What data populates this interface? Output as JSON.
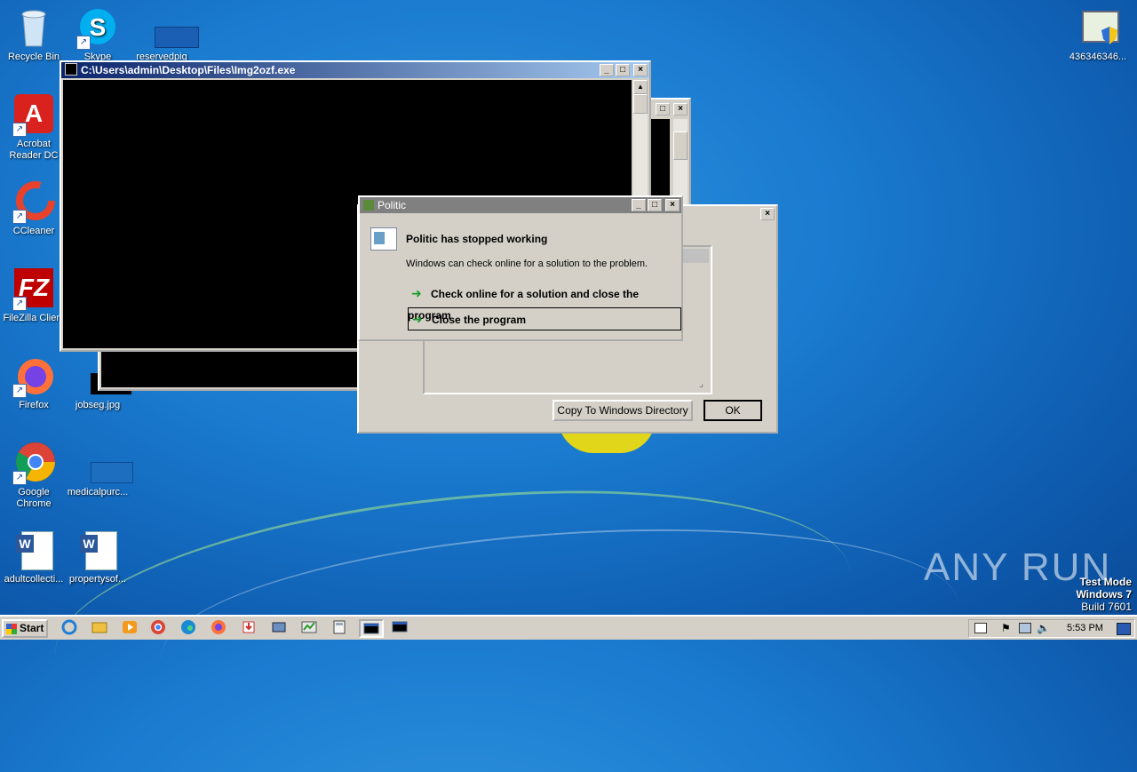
{
  "desktop": {
    "icons": [
      {
        "label": "Recycle Bin",
        "icon": "recycle-bin-icon"
      },
      {
        "label": "Skype",
        "icon": "skype-icon"
      },
      {
        "label": "reservedpig",
        "icon": "image-file-icon"
      },
      {
        "label": "Acrobat Reader DC",
        "icon": "acrobat-icon"
      },
      {
        "label": "CCleaner",
        "icon": "ccleaner-icon"
      },
      {
        "label": "FileZilla Client",
        "icon": "filezilla-icon"
      },
      {
        "label": "Firefox",
        "icon": "firefox-icon"
      },
      {
        "label": "jobseg.jpg",
        "icon": "image-file-icon"
      },
      {
        "label": "Google Chrome",
        "icon": "chrome-icon"
      },
      {
        "label": "medicalpurc...",
        "icon": "image-file-icon"
      },
      {
        "label": "adultcollecti...",
        "icon": "word-doc-icon"
      },
      {
        "label": "propertysof...",
        "icon": "word-doc-icon"
      },
      {
        "label": "436346346...",
        "icon": "shield-app-icon"
      }
    ],
    "watermark": {
      "brand": "ANY RUN",
      "mode": "Test Mode",
      "os": "Windows 7",
      "build": "Build 7601"
    }
  },
  "console_window": {
    "title": "C:\\Users\\admin\\Desktop\\Files\\Img2ozf.exe"
  },
  "error_dialog": {
    "title": "Politic",
    "heading": "Politic has stopped working",
    "message": "Windows can check online for a solution to the problem.",
    "option1": "Check online for a solution and close the program",
    "option2": "Close the program"
  },
  "details_dialog": {
    "copy_button": "Copy To Windows Directory",
    "ok_button": "OK"
  },
  "taskbar": {
    "start_label": "Start",
    "clock": "5:53 PM"
  }
}
